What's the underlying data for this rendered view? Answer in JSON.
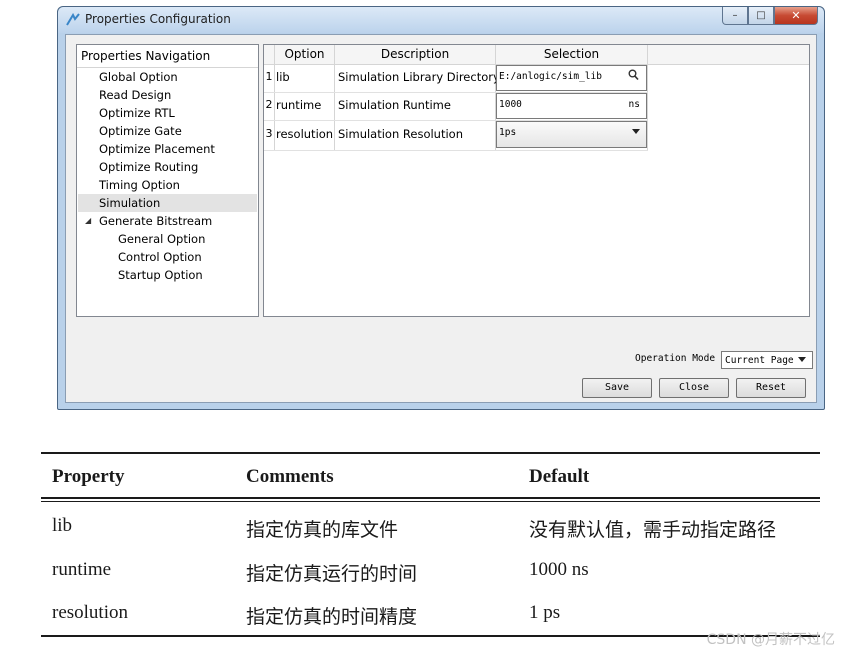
{
  "window": {
    "title": "Properties Configuration",
    "caption_buttons": {
      "minimize": "–",
      "maximize": "□",
      "close": "✕"
    }
  },
  "nav": {
    "header": "Properties Navigation",
    "items": [
      {
        "label": "Global Option"
      },
      {
        "label": "Read Design"
      },
      {
        "label": "Optimize RTL"
      },
      {
        "label": "Optimize Gate"
      },
      {
        "label": "Optimize Placement"
      },
      {
        "label": "Optimize Routing"
      },
      {
        "label": "Timing Option"
      },
      {
        "label": "Simulation",
        "selected": true
      },
      {
        "label": "Generate Bitstream",
        "expanded": true
      },
      {
        "label": "General Option"
      },
      {
        "label": "Control Option"
      },
      {
        "label": "Startup Option"
      }
    ]
  },
  "grid": {
    "columns": [
      "Option",
      "Description",
      "Selection"
    ],
    "rows": [
      {
        "num": "1",
        "option": "lib",
        "description": "Simulation Library Directory",
        "value": "E:/anlogic/sim_lib",
        "editor_icon": "search-icon"
      },
      {
        "num": "2",
        "option": "runtime",
        "description": "Simulation Runtime",
        "value": "1000",
        "unit": "ns"
      },
      {
        "num": "3",
        "option": "resolution",
        "description": "Simulation Resolution",
        "value": "1ps",
        "editor_icon": "dropdown-arrow-icon"
      }
    ]
  },
  "footer": {
    "operation_mode_label": "Operation Mode",
    "operation_mode_value": "Current Page",
    "save_label": "Save",
    "close_label": "Close",
    "reset_label": "Reset"
  },
  "doc_table": {
    "headers": [
      "Property",
      "Comments",
      "Default"
    ],
    "rows": [
      [
        "lib",
        "指定仿真的库文件",
        "没有默认值，需手动指定路径"
      ],
      [
        "runtime",
        "指定仿真运行的时间",
        "1000 ns"
      ],
      [
        "resolution",
        "指定仿真的时间精度",
        "1 ps"
      ]
    ]
  },
  "watermark": "CSDN @月薪不过亿",
  "colors": {
    "window_frame": "#b9d1ea",
    "client_bg": "#f0f0f0",
    "selected_nav_bg": "#e3e3e3",
    "close_button": "#c74a33"
  }
}
